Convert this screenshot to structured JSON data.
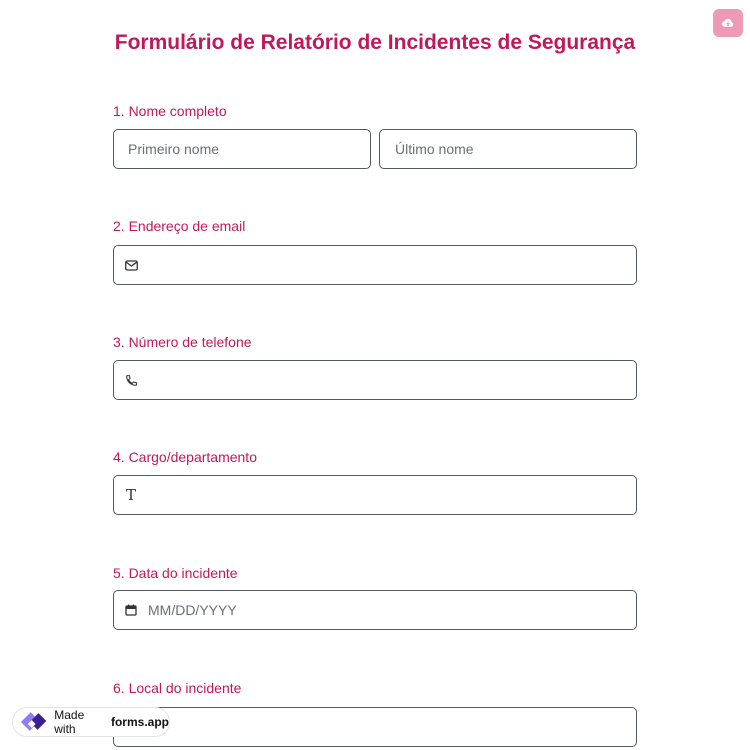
{
  "form": {
    "title": "Formulário de Relatório de Incidentes de Segurança",
    "accent_color": "#c2185b",
    "upload_icon": "cloud-upload-icon"
  },
  "questions": [
    {
      "label": "1.  Nome completo",
      "first_placeholder": "Primeiro nome",
      "last_placeholder": "Último nome"
    },
    {
      "label": "2. Endereço de email",
      "icon": "mail-icon",
      "placeholder": ""
    },
    {
      "label": "3. Número de telefone",
      "icon": "phone-icon",
      "placeholder": ""
    },
    {
      "label": "4. Cargo/departamento",
      "icon": "text-icon",
      "icon_glyph": "T",
      "placeholder": ""
    },
    {
      "label": "5. Data do incidente",
      "icon": "calendar-icon",
      "placeholder": "MM/DD/YYYY"
    },
    {
      "label": "6. Local do incidente",
      "placeholder": ""
    }
  ],
  "badge": {
    "prefix": "Made with",
    "brand": "forms.app",
    "icon": "forms-app-logo-icon"
  }
}
